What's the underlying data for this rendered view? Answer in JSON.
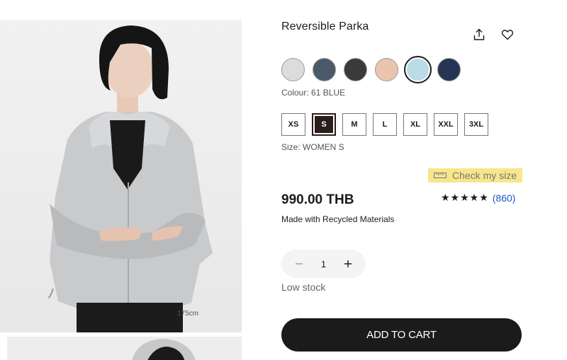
{
  "product": {
    "title": "Reversible Parka",
    "model_size": "175cm",
    "colour_label": "Colour: 61 BLUE",
    "size_label": "Size: WOMEN S",
    "price": "990.00 THB",
    "recycled": "Made with Recycled Materials",
    "stock": "Low stock"
  },
  "colours": [
    {
      "name": "light-gray",
      "hex": "#dcdcdc",
      "selected": false
    },
    {
      "name": "slate-blue",
      "hex": "#4b5a6b",
      "selected": false
    },
    {
      "name": "charcoal",
      "hex": "#383a3c",
      "selected": false
    },
    {
      "name": "beige",
      "hex": "#ebc4ad",
      "selected": false
    },
    {
      "name": "light-blue",
      "hex": "#b9dce7",
      "selected": true
    },
    {
      "name": "navy",
      "hex": "#243654",
      "selected": false
    }
  ],
  "sizes": [
    {
      "label": "XS",
      "selected": false
    },
    {
      "label": "S",
      "selected": true
    },
    {
      "label": "M",
      "selected": false
    },
    {
      "label": "L",
      "selected": false
    },
    {
      "label": "XL",
      "selected": false
    },
    {
      "label": "XXL",
      "selected": false
    },
    {
      "label": "3XL",
      "selected": false
    }
  ],
  "check_size": {
    "label": "Check my size",
    "icon": "ruler-icon",
    "highlight": "#f8e58c"
  },
  "rating": {
    "stars": "★★★★★",
    "count": "(860)"
  },
  "quantity": {
    "value": "1"
  },
  "cart": {
    "label": "ADD TO CART"
  },
  "icons": {
    "share": "share-icon",
    "favorite": "heart-icon"
  },
  "colors": {
    "text": "#1b1b1b",
    "link": "#1f57c8",
    "cart_bg": "#1b1b1b"
  }
}
